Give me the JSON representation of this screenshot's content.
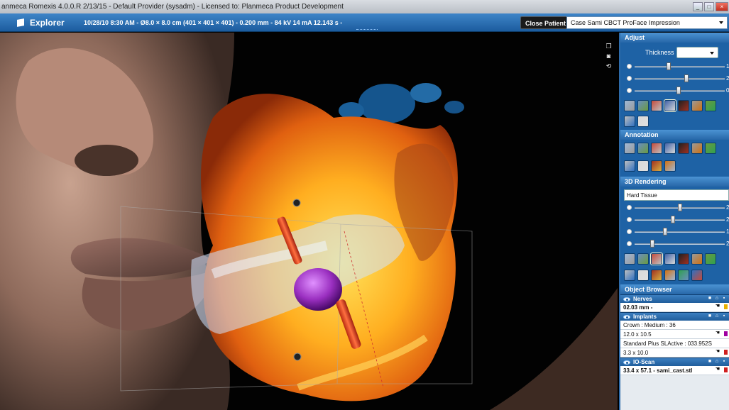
{
  "window": {
    "title": "anmeca Romexis 4.0.0.R  2/13/15 - Default Provider (sysadm) - Licensed to: Planmeca Product Development",
    "controls": [
      "minimize",
      "restore",
      "close"
    ]
  },
  "toolbar": {
    "module": "Explorer",
    "scan_info": "10/28/10 8:30 AM - Ø8.0 × 8.0 cm (401 × 401 × 401) - 0.200 mm - 84 kV 14 mA 12.143 s -",
    "close_patient": "Close Patient",
    "case_select": "Case Sami  CBCT ProFace Impression"
  },
  "panel": {
    "adjust": {
      "title": "Adjust",
      "thickness_label": "Thickness",
      "thickness_value": "",
      "sliders": [
        {
          "icon": "contrast-icon",
          "level": 0.37,
          "value": "1"
        },
        {
          "icon": "brightness-icon",
          "level": 0.58,
          "value": "2"
        },
        {
          "icon": "gamma-icon",
          "level": 0.49,
          "value": "0"
        }
      ],
      "tools": [
        "zoom-tool-icon",
        "rotate-tool-icon",
        "measure-tool-icon",
        "slice-tool-icon",
        "window-level-icon",
        "view-tool-icon",
        "hand-tool-icon",
        "pan-tool-icon",
        "camera-tool-icon"
      ]
    },
    "annotation": {
      "title": "Annotation",
      "tools": [
        "line-annotation-icon",
        "angle-annotation-icon",
        "polyline-annotation-icon",
        "text-annotation-icon",
        "arrow-annotation-icon",
        "freehand-annotation-icon",
        "ruler-annotation-icon",
        "point-annotation-icon",
        "area-annotation-icon",
        "pen-annotation-icon",
        "eraser-annotation-icon"
      ]
    },
    "rendering": {
      "title": "3D Rendering",
      "preset": "Hard Tissue",
      "sliders": [
        {
          "icon": "contrast-icon",
          "level": 0.5,
          "value": "2"
        },
        {
          "icon": "brightness-icon",
          "level": 0.42,
          "value": "2"
        },
        {
          "icon": "opacity-icon",
          "level": 0.33,
          "value": "1"
        },
        {
          "icon": "gamma-icon",
          "level": 0.18,
          "value": "2"
        }
      ],
      "tools": [
        "render-mode-icon",
        "light-icon",
        "clip-plane-icon",
        "red-box-icon",
        "green-box-icon",
        "blue-plane-icon",
        "cube-icon",
        "crop-box-icon",
        "skull-gold-icon",
        "skull-white-icon",
        "grid-icon",
        "brush-icon",
        "skull-outline-icon"
      ]
    },
    "object_browser": {
      "title": "Object Browser",
      "groups": [
        {
          "name": "Nerves",
          "rows": [
            {
              "text": "02.03 mm -",
              "bold": true,
              "color": "#e8b000"
            }
          ]
        },
        {
          "name": "Implants",
          "rows": [
            {
              "text": "Crown : Medium : 36",
              "bold": false,
              "color": null
            },
            {
              "text": "12.0 x 10.5",
              "bold": false,
              "color": "#a000a0"
            },
            {
              "text": "Standard Plus SLActive : 033.952S",
              "bold": false,
              "color": null
            },
            {
              "text": "3.3 x 10.0",
              "bold": false,
              "color": "#d02020"
            }
          ]
        },
        {
          "name": "IO-Scan",
          "rows": [
            {
              "text": "33.4 x 57.1 - sami_cast.stl",
              "bold": true,
              "color": "#d02020"
            }
          ]
        }
      ]
    }
  },
  "viewport": {
    "tools": [
      "detach-icon",
      "snapshot-icon",
      "reset-view-icon"
    ]
  }
}
